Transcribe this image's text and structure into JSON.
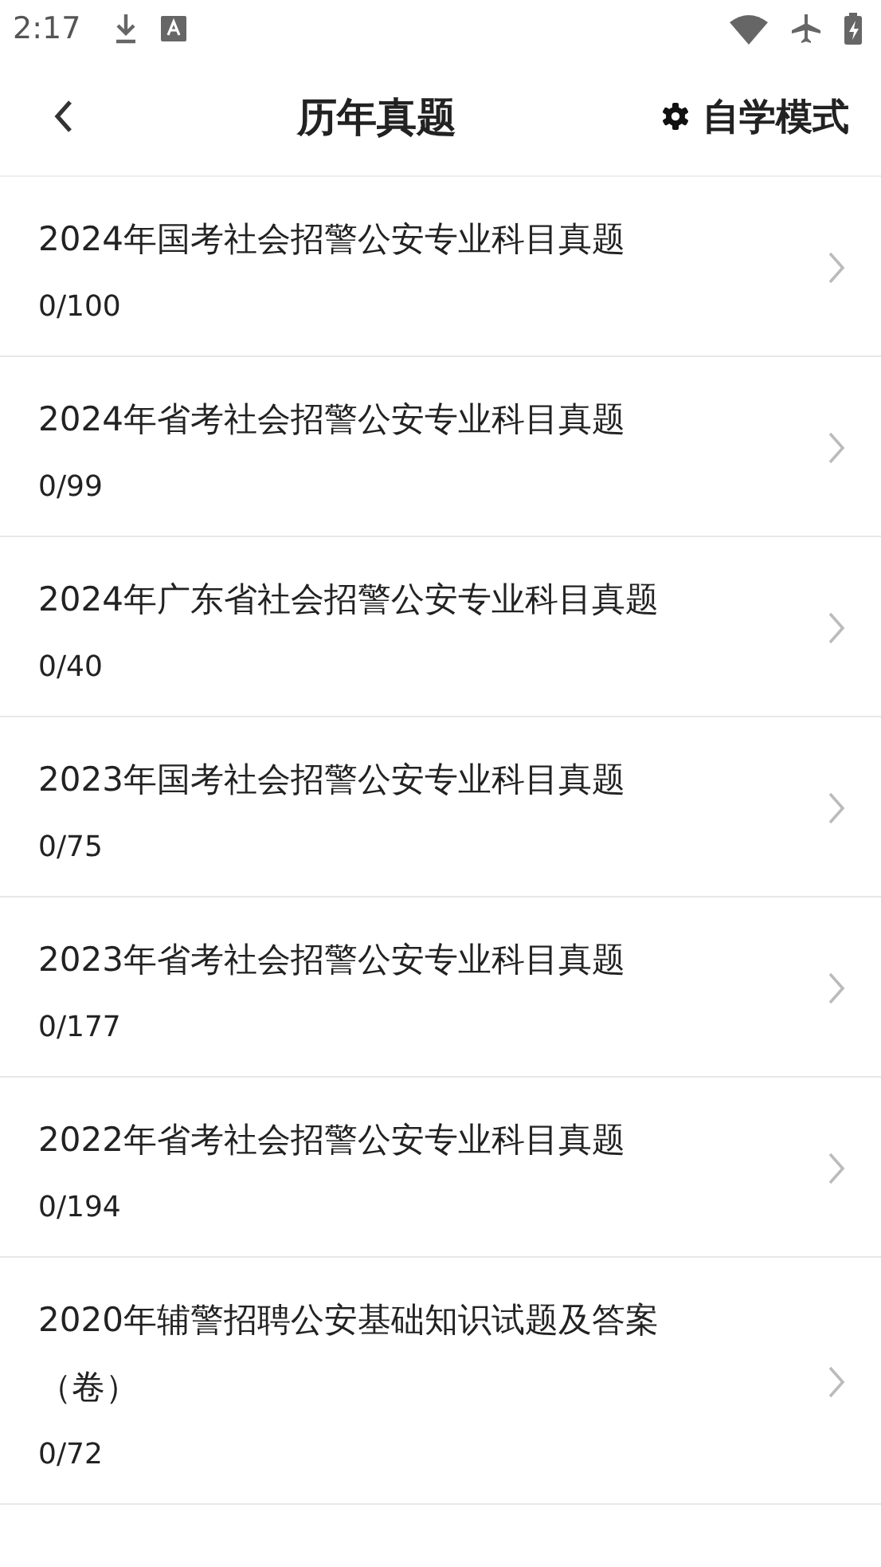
{
  "status_bar": {
    "time": "2:17"
  },
  "header": {
    "title": "历年真题",
    "action": "自学模式"
  },
  "items": [
    {
      "title": "2024年国考社会招警公安专业科目真题",
      "progress": "0/100"
    },
    {
      "title": "2024年省考社会招警公安专业科目真题",
      "progress": "0/99"
    },
    {
      "title": "2024年广东省社会招警公安专业科目真题",
      "progress": "0/40"
    },
    {
      "title": "2023年国考社会招警公安专业科目真题",
      "progress": "0/75"
    },
    {
      "title": "2023年省考社会招警公安专业科目真题",
      "progress": "0/177"
    },
    {
      "title": "2022年省考社会招警公安专业科目真题",
      "progress": "0/194"
    },
    {
      "title": "2020年辅警招聘公安基础知识试题及答案（卷）",
      "progress": "0/72"
    }
  ]
}
